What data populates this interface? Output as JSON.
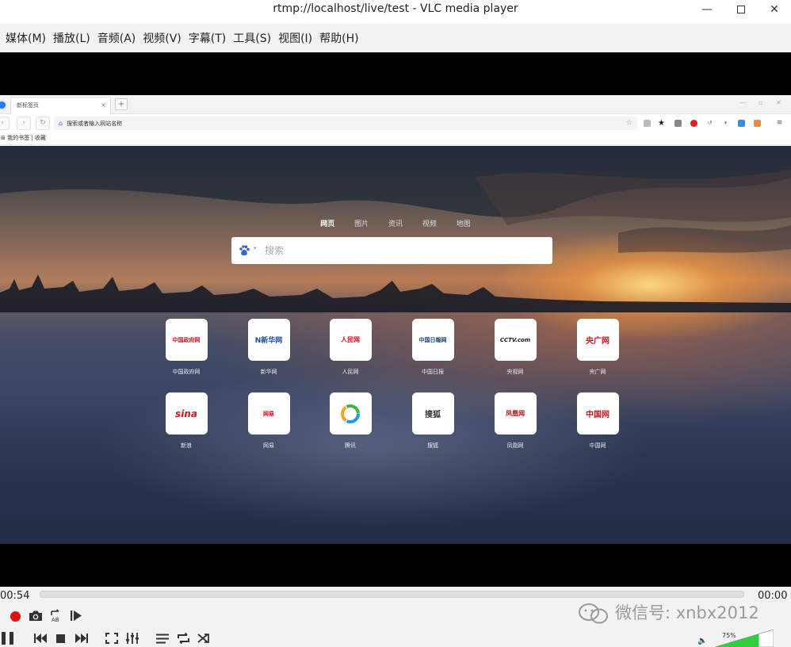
{
  "window": {
    "title": "rtmp://localhost/live/test - VLC media player",
    "min_glyph": "—",
    "close_glyph": "✕"
  },
  "menu": [
    "媒体(M)",
    "播放(L)",
    "音频(A)",
    "视频(V)",
    "字幕(T)",
    "工具(S)",
    "视图(I)",
    "帮助(H)"
  ],
  "browser": {
    "tab_title": "新标签页",
    "tab_close": "×",
    "new_tab": "+",
    "address_placeholder": "搜索或者输入网站名称",
    "bookmarks": "我的书签 | 收藏"
  },
  "newtab": {
    "search_tabs": [
      {
        "label": "网页",
        "active": true
      },
      {
        "label": "图片",
        "active": false
      },
      {
        "label": "资讯",
        "active": false
      },
      {
        "label": "视频",
        "active": false
      },
      {
        "label": "地图",
        "active": false
      }
    ],
    "search_placeholder": "搜索",
    "sites_row1": [
      {
        "label": "中国政府网",
        "logo": "中国政府网",
        "color": "#c8161d"
      },
      {
        "label": "新华网",
        "logo": "N新华网",
        "color": "#1b4d9c"
      },
      {
        "label": "人民网",
        "logo": "人民网",
        "color": "#d0161c"
      },
      {
        "label": "中国日报",
        "logo": "中国日報网",
        "color": "#1c3f7c"
      },
      {
        "label": "央视网",
        "logo": "CCTV.com",
        "color": "#1a1a1a"
      },
      {
        "label": "央广网",
        "logo": "央广网",
        "color": "#c4151c"
      }
    ],
    "sites_row2": [
      {
        "label": "新浪",
        "logo": "sina",
        "color": "#d8161d"
      },
      {
        "label": "网易",
        "logo": "网易",
        "color": "#c4151c"
      },
      {
        "label": "腾讯",
        "logo": "",
        "color": "#1a9bf0"
      },
      {
        "label": "搜狐",
        "logo": "搜狐",
        "color": "#333333"
      },
      {
        "label": "凤凰网",
        "logo": "凤凰网",
        "color": "#b8161d"
      },
      {
        "label": "中国网",
        "logo": "中国网",
        "color": "#c4151c"
      }
    ]
  },
  "player": {
    "elapsed": "00:54",
    "total": "00:00",
    "seek_fraction": 0.0,
    "volume_pct": "75%",
    "volume_fraction": 0.75,
    "watermark": "微信号: xnbx2012",
    "accent_record": "#e01010",
    "accent_volume": "#2fcf3f"
  }
}
